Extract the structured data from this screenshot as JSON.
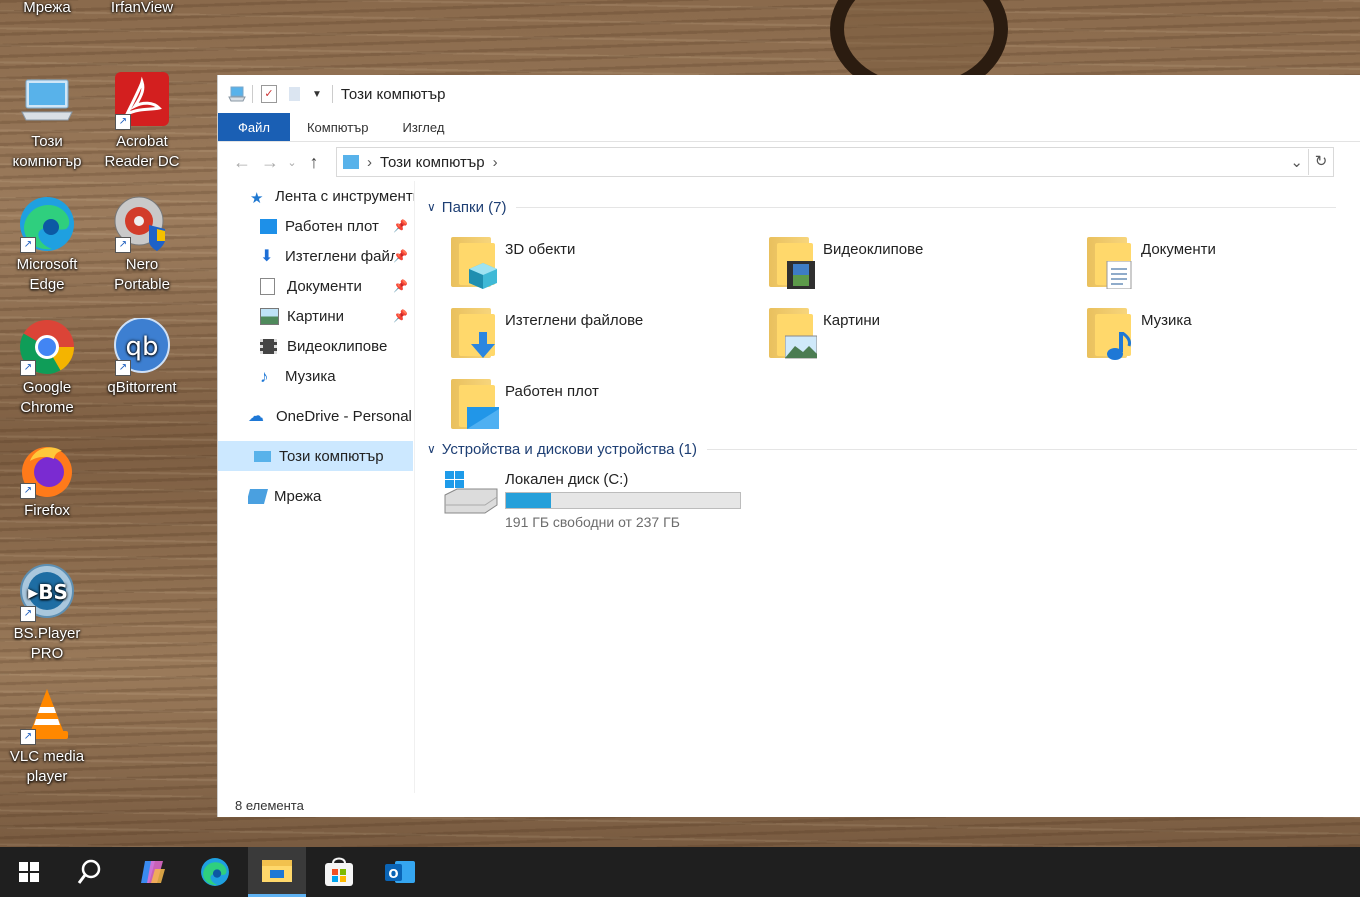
{
  "desktop": {
    "icons": [
      {
        "label": "Мрежа",
        "icon": "network-icon"
      },
      {
        "label": "IrfanView",
        "icon": "irfanview-icon"
      },
      {
        "label": "Този компютър",
        "icon": "this-pc-icon"
      },
      {
        "label": "Acrobat Reader DC",
        "icon": "acrobat-icon"
      },
      {
        "label": "Microsoft Edge",
        "icon": "edge-icon"
      },
      {
        "label": "Nero Portable",
        "icon": "nero-icon"
      },
      {
        "label": "Google Chrome",
        "icon": "chrome-icon"
      },
      {
        "label": "qBittorrent",
        "icon": "qbittorrent-icon"
      },
      {
        "label": "Firefox",
        "icon": "firefox-icon"
      },
      {
        "label": "BS.Player PRO",
        "icon": "bsplayer-icon"
      },
      {
        "label": "VLC media player",
        "icon": "vlc-icon"
      }
    ]
  },
  "explorer": {
    "title": "Този компютър",
    "ribbon_tabs": [
      "Файл",
      "Компютър",
      "Изглед"
    ],
    "address": "Този компютър",
    "nav": {
      "quick_access": "Лента с инструменти",
      "items": [
        {
          "label": "Работен плот",
          "pinned": true
        },
        {
          "label": "Изтеглени файлове",
          "pinned": true
        },
        {
          "label": "Документи",
          "pinned": true
        },
        {
          "label": "Картини",
          "pinned": true
        },
        {
          "label": "Видеоклипове",
          "pinned": false
        },
        {
          "label": "Музика",
          "pinned": false
        }
      ],
      "onedrive": "OneDrive - Personal",
      "this_pc": "Този компютър",
      "network": "Мрежа"
    },
    "folders_header": "Папки (7)",
    "folders": [
      "3D обекти",
      "Видеоклипове",
      "Документи",
      "Изтеглени файлове",
      "Картини",
      "Музика",
      "Работен плот"
    ],
    "devices_header": "Устройства и дискови устройства (1)",
    "drive": {
      "name": "Локален диск (C:)",
      "free_text": "191 ГБ свободни от 237 ГБ",
      "used_fraction": 0.194
    },
    "status": "8 елемента"
  },
  "taskbar": [
    "start-icon",
    "search-icon",
    "copilot-icon",
    "edge-icon",
    "file-explorer-icon",
    "store-icon",
    "outlook-icon"
  ],
  "colors": {
    "accent": "#1a5fb4",
    "drive_bar": "#26a0da",
    "taskbar": "#1f1f1f"
  }
}
